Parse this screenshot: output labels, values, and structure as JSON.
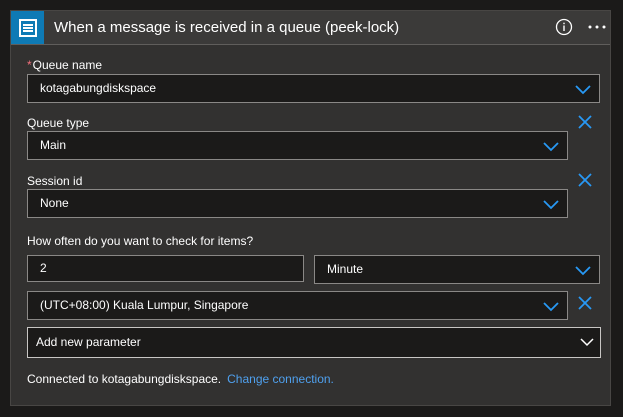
{
  "header": {
    "title": "When a message is received in a queue (peek-lock)",
    "icon": "service-bus-icon",
    "badge_color": "#0e7ab5"
  },
  "fields": {
    "queue_name": {
      "label": "Queue name",
      "required_mark": "*",
      "value": "kotagabungdiskspace"
    },
    "queue_type": {
      "label": "Queue type",
      "value": "Main"
    },
    "session_id": {
      "label": "Session id",
      "value": "None"
    },
    "frequency": {
      "label": "How often do you want to check for items?",
      "interval": "2",
      "unit": "Minute"
    },
    "time_zone": {
      "value": "(UTC+08:00) Kuala Lumpur, Singapore"
    }
  },
  "add_parameter": {
    "label": "Add new parameter"
  },
  "footer": {
    "connected_text": "Connected to kotagabungdiskspace.",
    "change_link": "Change connection."
  },
  "colors": {
    "accent": "#2899f5",
    "link": "#4fa0ee",
    "required": "#f1707b"
  }
}
